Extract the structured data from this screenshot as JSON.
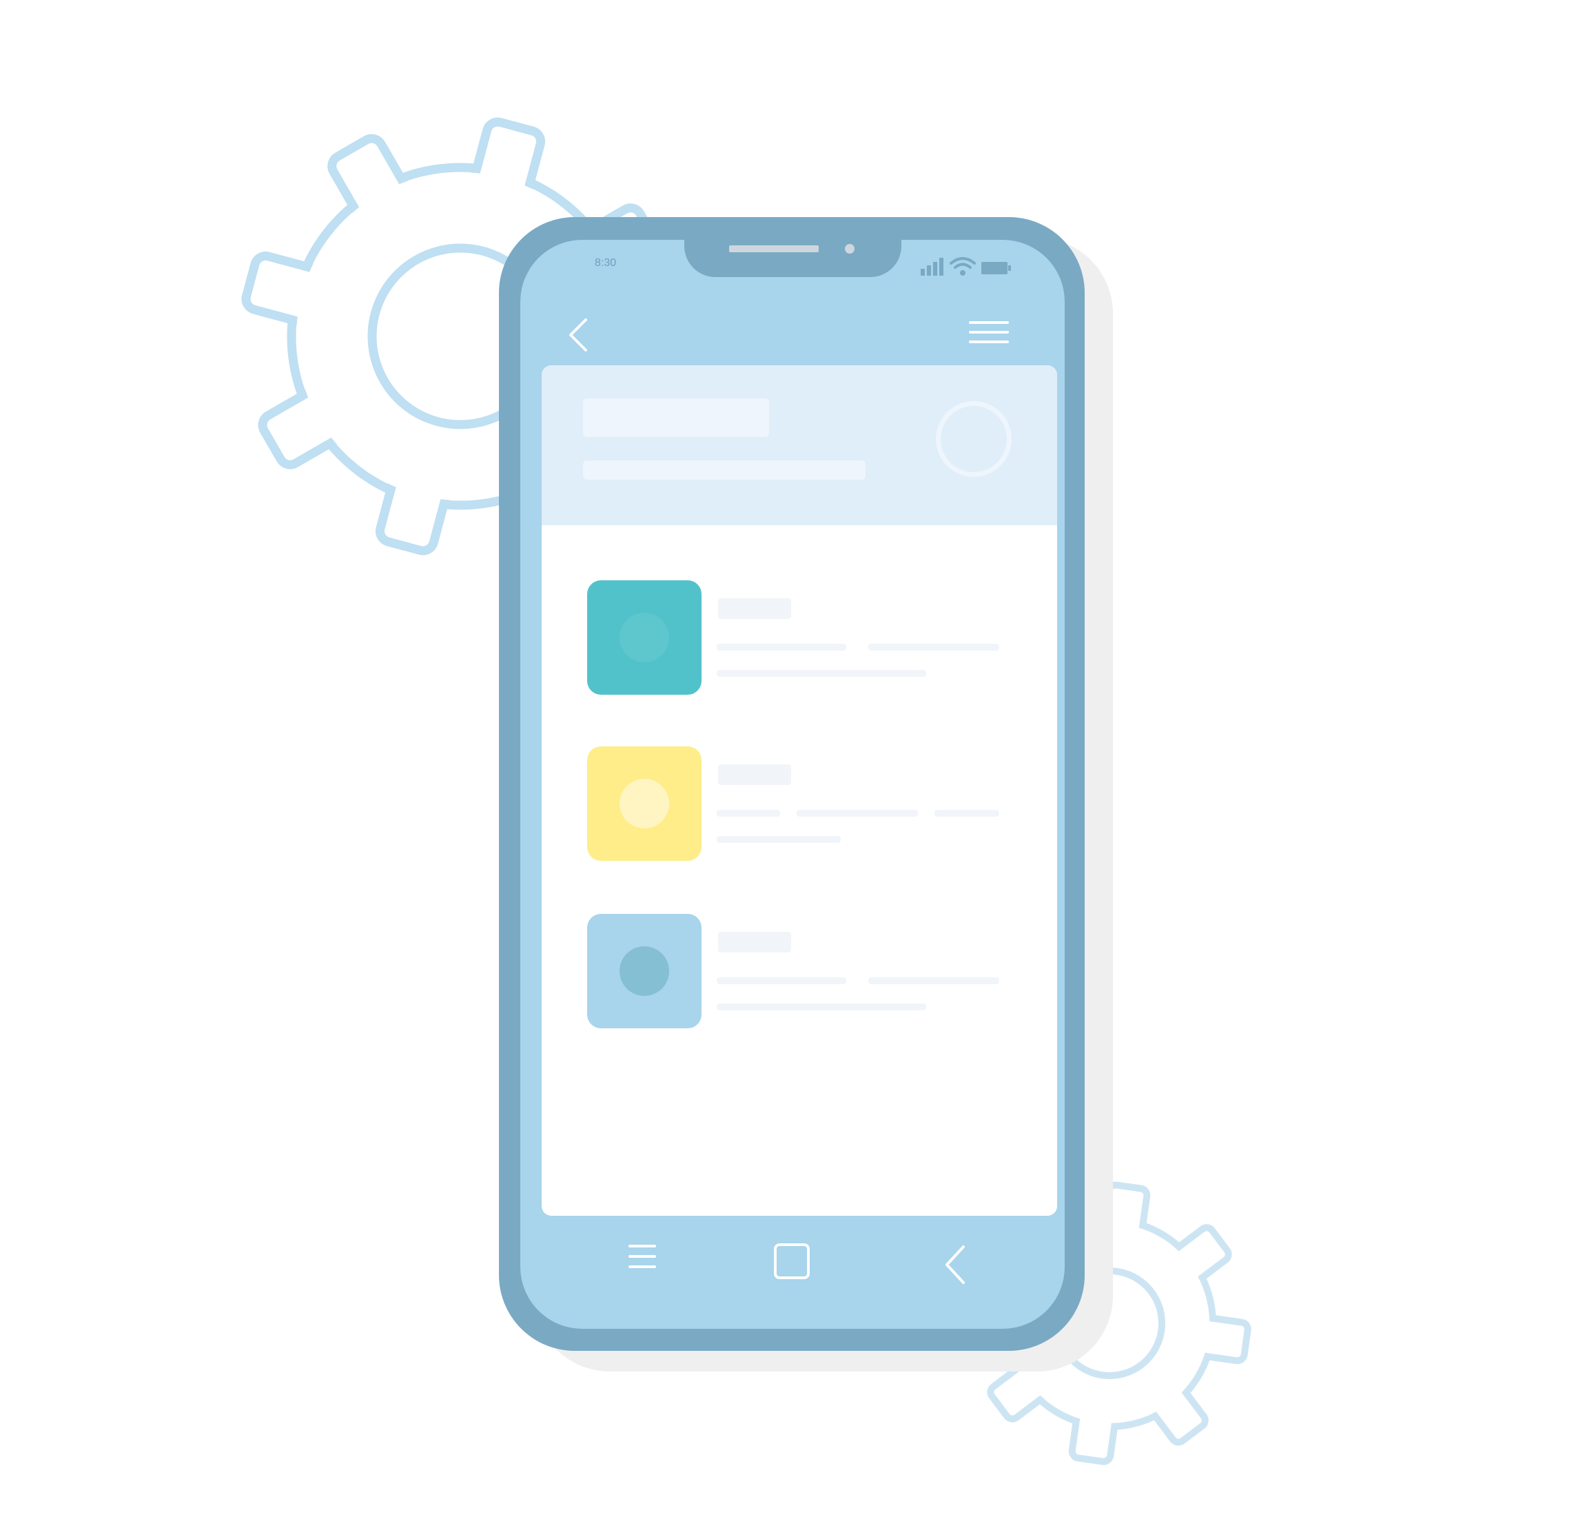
{
  "status_bar": {
    "time": "8:30",
    "signal_icon": "signal-bars-icon",
    "wifi_icon": "wifi-icon",
    "battery_icon": "battery-icon"
  },
  "app_bar": {
    "back_icon": "chevron-left-icon",
    "menu_icon": "hamburger-menu-icon"
  },
  "header_card": {
    "title": "",
    "subtitle": "",
    "avatar_icon": "avatar-circle-icon"
  },
  "list": {
    "items": [
      {
        "title": "",
        "icon_color": "#52c2ca",
        "dot_color": "#5ec6cd"
      },
      {
        "title": "",
        "icon_color": "#feed89",
        "dot_color": "#fff5c2"
      },
      {
        "title": "",
        "icon_color": "#a8d4ec",
        "dot_color": "#85bfd4"
      }
    ]
  },
  "bottom_nav": {
    "menu_icon": "hamburger-menu-icon",
    "home_icon": "home-square-icon",
    "back_icon": "chevron-left-icon"
  },
  "colors": {
    "frame": "#7aa9c4",
    "screen": "#a8d4ec",
    "header_card": "#dfeef9",
    "gear_outline": "#bfdff2"
  }
}
